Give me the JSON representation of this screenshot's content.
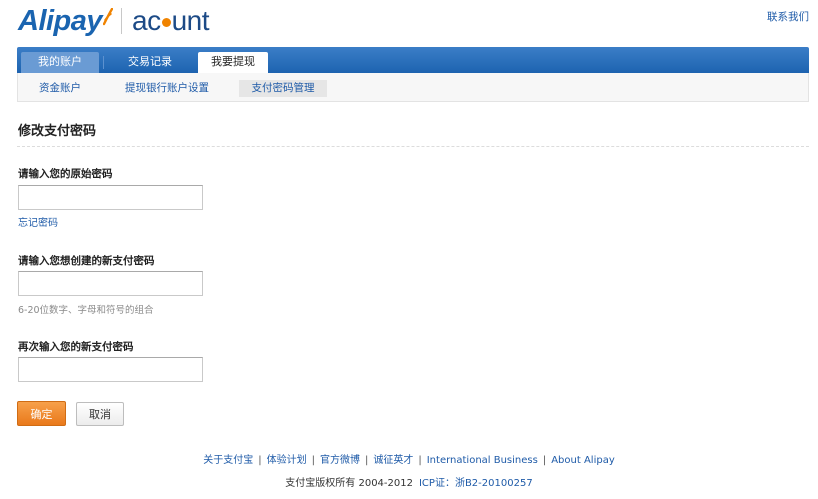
{
  "brand": {
    "logo_text": "Alipay",
    "product_prefix": "ac",
    "product_suffix": "unt",
    "brand_color": "#1a64b0",
    "accent_color": "#f08300"
  },
  "header": {
    "contact_link": "联系我们"
  },
  "tabs": [
    {
      "label": "我的账户",
      "active": false
    },
    {
      "label": "交易记录",
      "active": false
    },
    {
      "label": "我要提现",
      "active": true
    }
  ],
  "subnav": [
    {
      "label": "资金账户",
      "active": false
    },
    {
      "label": "提现银行账户设置",
      "active": false
    },
    {
      "label": "支付密码管理",
      "active": true
    }
  ],
  "main": {
    "title": "修改支付密码",
    "fields": [
      {
        "label": "请输入您的原始密码",
        "value": "",
        "help_link": "忘记密码"
      },
      {
        "label": "请输入您想创建的新支付密码",
        "value": "",
        "hint": "6-20位数字、字母和符号的组合"
      },
      {
        "label": "再次输入您的新支付密码",
        "value": ""
      }
    ],
    "confirm_label": "确定",
    "cancel_label": "取消"
  },
  "footer": {
    "links": [
      "关于支付宝",
      "体验计划",
      "官方微博",
      "诚征英才",
      "International Business",
      "About Alipay"
    ],
    "copyright": "支付宝版权所有 2004-2012",
    "icp": "ICP证：浙B2-20100257"
  }
}
